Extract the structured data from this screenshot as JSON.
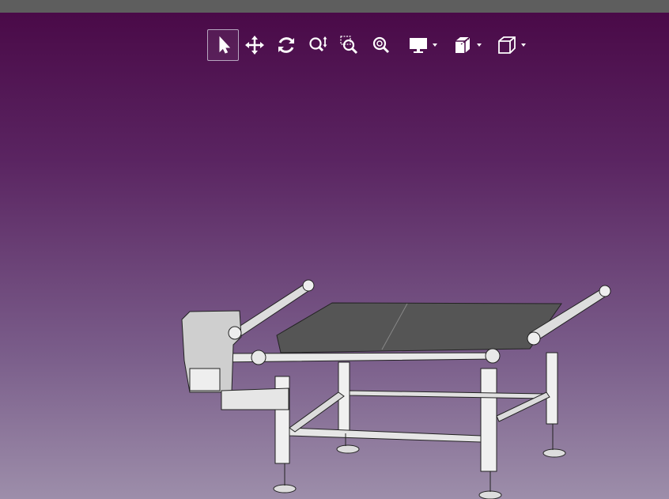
{
  "window": {
    "title": ""
  },
  "toolbar": {
    "tools": [
      {
        "name": "select-tool-button",
        "icon": "cursor-arrow-icon",
        "active": true
      },
      {
        "name": "pan-tool-button",
        "icon": "move-arrows-icon",
        "active": false
      },
      {
        "name": "rotate-tool-button",
        "icon": "rotate-icon",
        "active": false
      },
      {
        "name": "zoom-tool-button",
        "icon": "zoom-vertical-icon",
        "active": false
      },
      {
        "name": "zoom-window-button",
        "icon": "zoom-window-icon",
        "active": false
      },
      {
        "name": "zoom-fit-button",
        "icon": "zoom-fit-icon",
        "active": false
      }
    ],
    "menus": [
      {
        "name": "display-mode-menu",
        "icon": "monitor-icon"
      },
      {
        "name": "section-view-menu",
        "icon": "section-cube-icon"
      },
      {
        "name": "standard-view-menu",
        "icon": "view-cube-icon"
      }
    ]
  },
  "viewport": {
    "background_top": "#4a0a48",
    "background_bottom": "#9d8eaa",
    "model": "conveyor-table-3d-model"
  }
}
